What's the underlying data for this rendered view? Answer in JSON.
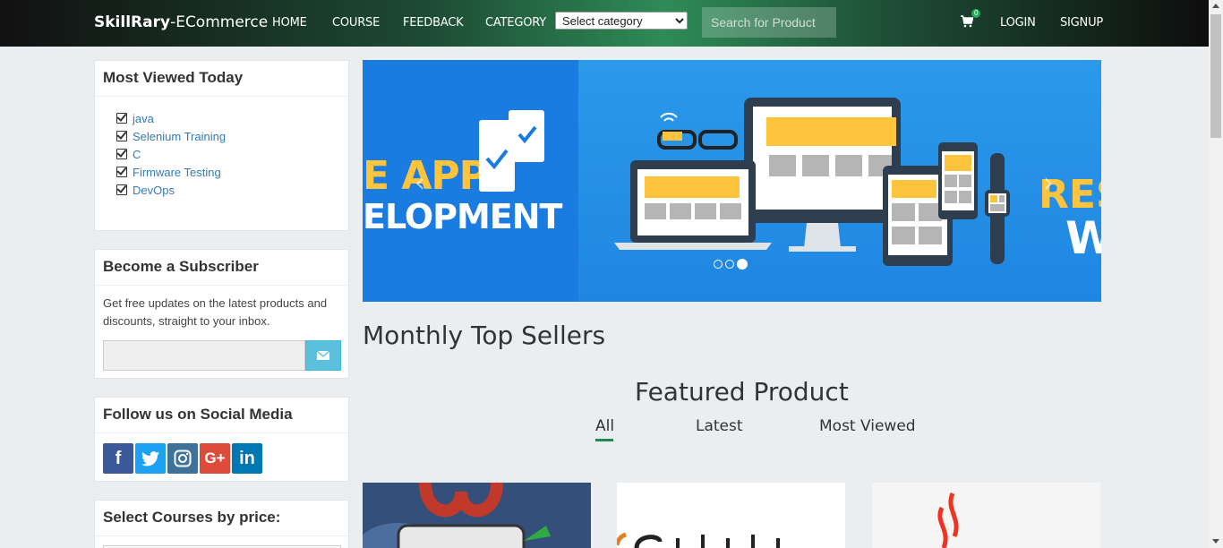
{
  "navbar": {
    "brand_bold": "SkillRary",
    "brand_rest": "-ECommerce",
    "links": [
      "HOME",
      "COURSE",
      "FEEDBACK",
      "CATEGORY"
    ],
    "category_select": "Select category",
    "search_placeholder": "Search for Product",
    "cart_count": "0",
    "login": "LOGIN",
    "signup": "SIGNUP"
  },
  "sidebar": {
    "most_viewed": {
      "title": "Most Viewed Today",
      "items": [
        "java",
        "Selenium Training",
        "C",
        "Firmware Testing",
        "DevOps"
      ]
    },
    "subscriber": {
      "title": "Become a Subscriber",
      "text": "Get free updates on the latest products and discounts, straight to your inbox."
    },
    "social": {
      "title": "Follow us on Social Media",
      "icons": [
        "facebook-icon",
        "twitter-icon",
        "instagram-icon",
        "google-plus-icon",
        "linkedin-icon"
      ],
      "labels": [
        "f",
        "t",
        "◎",
        "G+",
        "in"
      ],
      "colors": [
        "#3b5998",
        "#1da1f2",
        "#3f729b",
        "#dd4b39",
        "#0077b5"
      ]
    },
    "price": {
      "title": "Select Courses by price:"
    }
  },
  "banner": {
    "left_line1": "E APP",
    "left_line2": "ELOPMENT",
    "right_line1": "RES",
    "right_line2": "W",
    "slide_count": 3,
    "active_slide": 3
  },
  "main": {
    "monthly_title": "Monthly Top Sellers",
    "featured_title": "Featured Product",
    "tabs": [
      "All",
      "Latest",
      "Most Viewed"
    ],
    "active_tab": "All"
  },
  "colors": {
    "accent_green": "#1f8a4f",
    "link_blue": "#337ab7",
    "subscribe_btn": "#5bc0de",
    "banner_yellow": "#ffc43d"
  }
}
